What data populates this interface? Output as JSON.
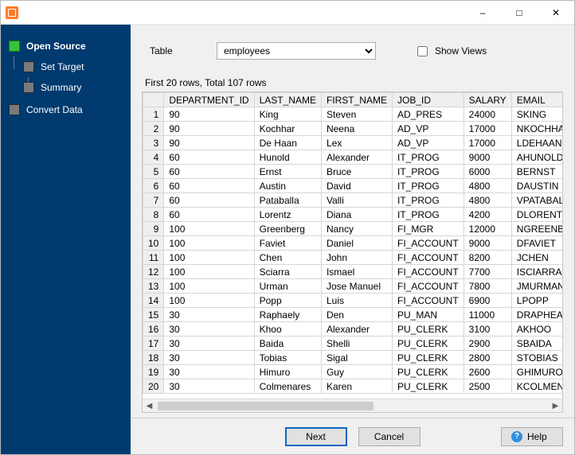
{
  "titlebar": {
    "title": ""
  },
  "sidebar": {
    "steps": [
      {
        "label": "Open Source",
        "active": true
      },
      {
        "label": "Set Target",
        "active": false
      },
      {
        "label": "Summary",
        "active": false
      },
      {
        "label": "Convert Data",
        "active": false
      }
    ]
  },
  "tableSelector": {
    "label": "Table",
    "value": "employees",
    "options": [
      "employees"
    ],
    "showViews": {
      "label": "Show Views",
      "checked": false
    }
  },
  "status": "First 20 rows, Total 107 rows",
  "grid": {
    "columns": [
      "DEPARTMENT_ID",
      "LAST_NAME",
      "FIRST_NAME",
      "JOB_ID",
      "SALARY",
      "EMAIL"
    ],
    "rows": [
      [
        "90",
        "King",
        "Steven",
        "AD_PRES",
        "24000",
        "SKING"
      ],
      [
        "90",
        "Kochhar",
        "Neena",
        "AD_VP",
        "17000",
        "NKOCHHAR"
      ],
      [
        "90",
        "De Haan",
        "Lex",
        "AD_VP",
        "17000",
        "LDEHAAN"
      ],
      [
        "60",
        "Hunold",
        "Alexander",
        "IT_PROG",
        "9000",
        "AHUNOLD"
      ],
      [
        "60",
        "Ernst",
        "Bruce",
        "IT_PROG",
        "6000",
        "BERNST"
      ],
      [
        "60",
        "Austin",
        "David",
        "IT_PROG",
        "4800",
        "DAUSTIN"
      ],
      [
        "60",
        "Pataballa",
        "Valli",
        "IT_PROG",
        "4800",
        "VPATABAL"
      ],
      [
        "60",
        "Lorentz",
        "Diana",
        "IT_PROG",
        "4200",
        "DLORENTZ"
      ],
      [
        "100",
        "Greenberg",
        "Nancy",
        "FI_MGR",
        "12000",
        "NGREENBE"
      ],
      [
        "100",
        "Faviet",
        "Daniel",
        "FI_ACCOUNT",
        "9000",
        "DFAVIET"
      ],
      [
        "100",
        "Chen",
        "John",
        "FI_ACCOUNT",
        "8200",
        "JCHEN"
      ],
      [
        "100",
        "Sciarra",
        "Ismael",
        "FI_ACCOUNT",
        "7700",
        "ISCIARRA"
      ],
      [
        "100",
        "Urman",
        "Jose Manuel",
        "FI_ACCOUNT",
        "7800",
        "JMURMAN"
      ],
      [
        "100",
        "Popp",
        "Luis",
        "FI_ACCOUNT",
        "6900",
        "LPOPP"
      ],
      [
        "30",
        "Raphaely",
        "Den",
        "PU_MAN",
        "11000",
        "DRAPHEAL"
      ],
      [
        "30",
        "Khoo",
        "Alexander",
        "PU_CLERK",
        "3100",
        "AKHOO"
      ],
      [
        "30",
        "Baida",
        "Shelli",
        "PU_CLERK",
        "2900",
        "SBAIDA"
      ],
      [
        "30",
        "Tobias",
        "Sigal",
        "PU_CLERK",
        "2800",
        "STOBIAS"
      ],
      [
        "30",
        "Himuro",
        "Guy",
        "PU_CLERK",
        "2600",
        "GHIMURO"
      ],
      [
        "30",
        "Colmenares",
        "Karen",
        "PU_CLERK",
        "2500",
        "KCOLMENA"
      ]
    ]
  },
  "footer": {
    "next": "Next",
    "cancel": "Cancel",
    "help": "Help"
  }
}
